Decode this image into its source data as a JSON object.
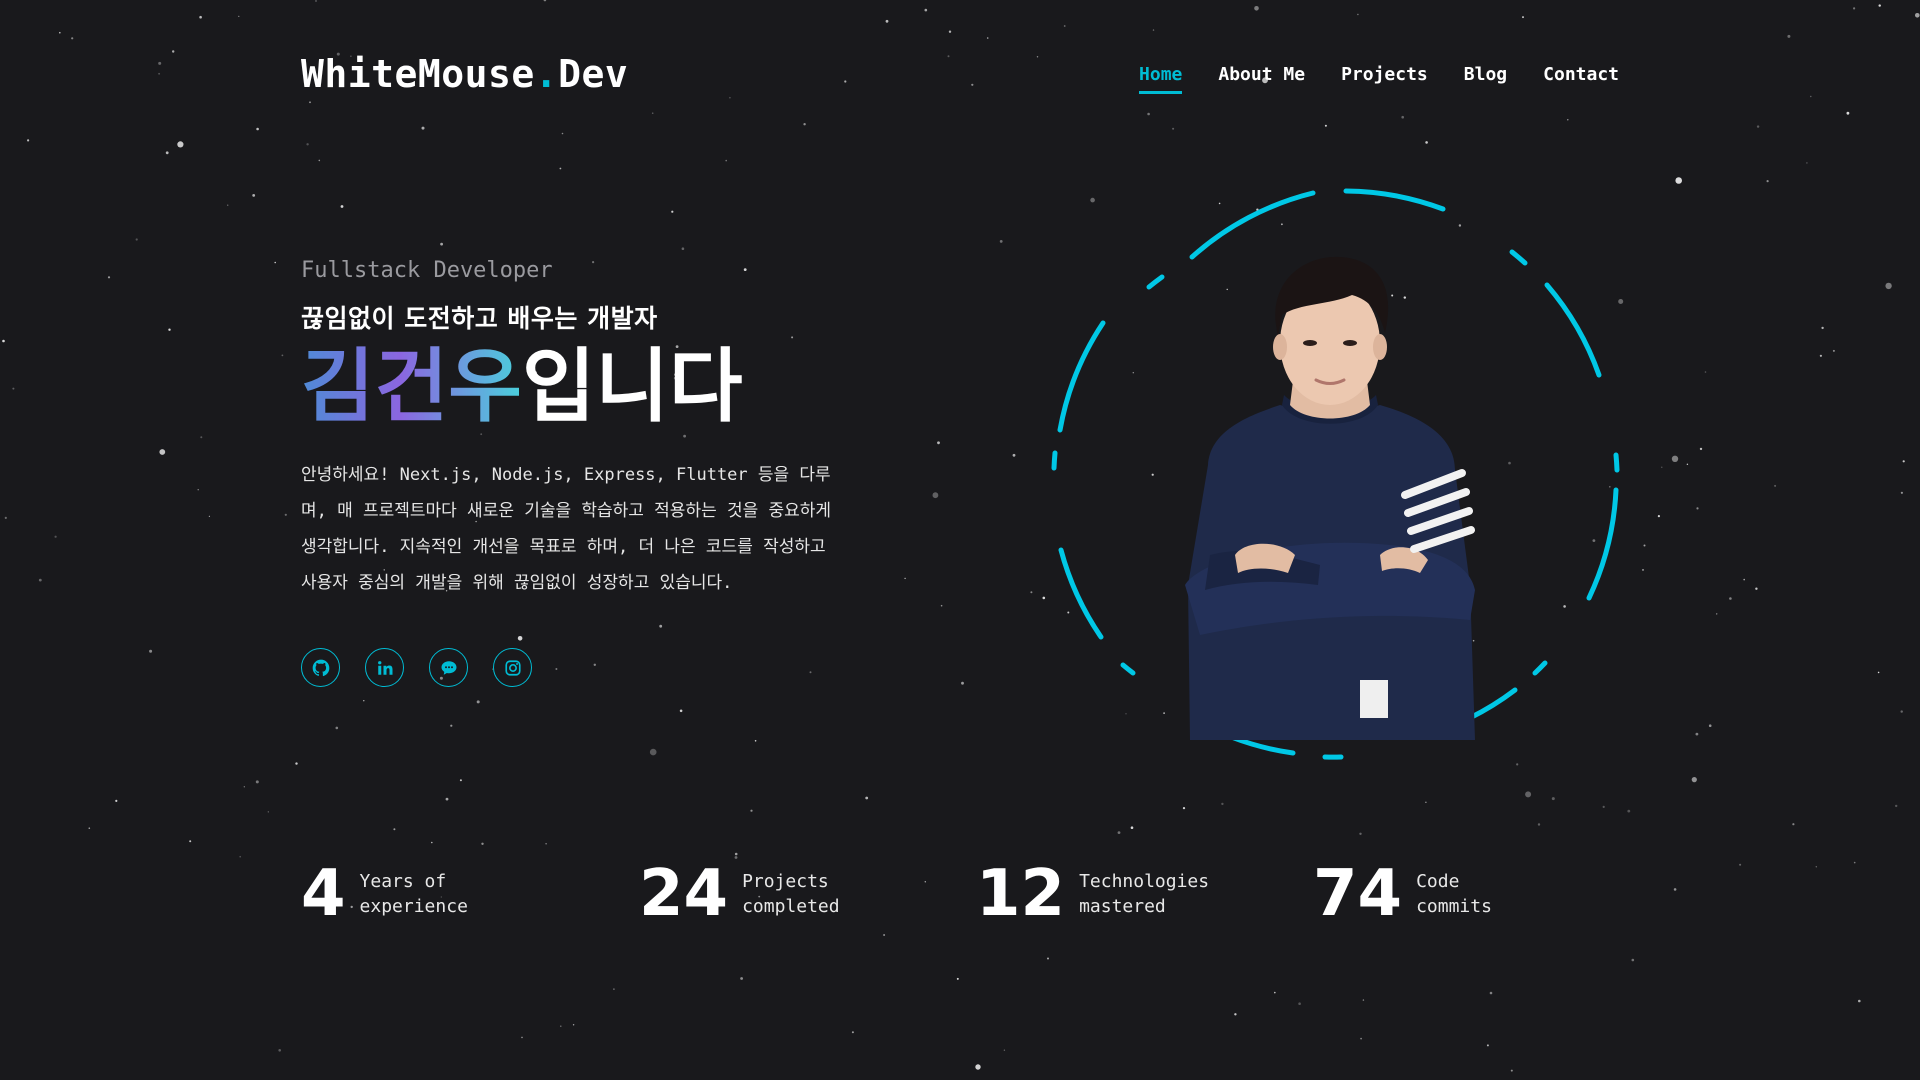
{
  "brand": {
    "name_part1": "WhiteMouse",
    "name_dot": ".",
    "name_part2": "Dev"
  },
  "nav": {
    "items": [
      {
        "label": "Home",
        "active": true
      },
      {
        "label": "About Me",
        "active": false
      },
      {
        "label": "Projects",
        "active": false
      },
      {
        "label": "Blog",
        "active": false
      },
      {
        "label": "Contact",
        "active": false
      }
    ]
  },
  "hero": {
    "subtitle": "Fullstack Developer",
    "tagline": "끊임없이 도전하고 배우는 개발자",
    "name": "김건우",
    "name_suffix": "입니다",
    "intro_lines": [
      "안녕하세요! Next.js, Node.js, Express, Flutter 등을 다루",
      "며, 매 프로젝트마다 새로운 기술을 학습하고 적용하는 것을 중요하게",
      "생각합니다. 지속적인 개선을 목표로 하며, 더 나은 코드를 작성하고",
      "사용자 중심의 개발을 위해 끊임없이 성장하고 있습니다."
    ]
  },
  "socials": [
    {
      "icon": "github-icon"
    },
    {
      "icon": "linkedin-icon"
    },
    {
      "icon": "chat-icon"
    },
    {
      "icon": "instagram-icon"
    }
  ],
  "stats": [
    {
      "value": "4",
      "label_line1": "Years of",
      "label_line2": "experience"
    },
    {
      "value": "24",
      "label_line1": "Projects",
      "label_line2": "completed"
    },
    {
      "value": "12",
      "label_line1": "Technologies",
      "label_line2": "mastered"
    },
    {
      "value": "74",
      "label_line1": "Code",
      "label_line2": "commits"
    }
  ],
  "colors": {
    "background": "#19191c",
    "accent": "#00bcd4",
    "text": "#ffffff",
    "muted": "#9a9a9f"
  }
}
